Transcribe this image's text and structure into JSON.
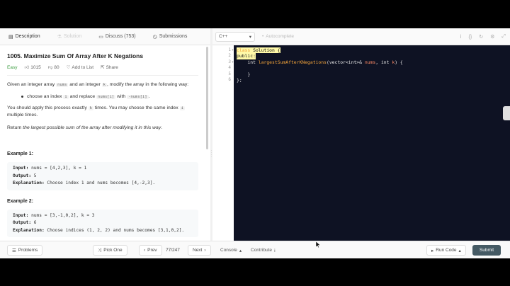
{
  "tabs": [
    {
      "label": "Description",
      "icon": "document-icon",
      "active": true
    },
    {
      "label": "Solution",
      "icon": "flask-icon",
      "disabled": true
    },
    {
      "label": "Discuss (753)",
      "icon": "chat-icon"
    },
    {
      "label": "Submissions",
      "icon": "history-icon"
    }
  ],
  "problem": {
    "title": "1005. Maximize Sum Of Array After K Negations",
    "difficulty": "Easy",
    "likes": "1015",
    "dislikes": "80",
    "add_to_list": "Add to List",
    "share": "Share",
    "intro_a": "Given an integer array ",
    "intro_code1": "nums",
    "intro_b": " and an integer ",
    "intro_code2": "k",
    "intro_c": ", modify the array in the following way:",
    "bullet_a": "choose an index ",
    "bullet_code1": "i",
    "bullet_b": " and replace ",
    "bullet_code2": "nums[i]",
    "bullet_c": " with ",
    "bullet_code3": "-nums[i]",
    "bullet_d": ".",
    "apply_a": "You should apply this process exactly ",
    "apply_code": "k",
    "apply_b": " times. You may choose the same index ",
    "apply_code2": "i",
    "apply_c": " multiple times.",
    "return_a": "Return ",
    "return_em": "the largest possible sum of the array after modifying it in this way",
    "return_b": ".",
    "examples": [
      {
        "heading": "Example 1:",
        "input_label": "Input:",
        "input": " nums = [4,2,3], k = 1",
        "output_label": "Output:",
        "output": " 5",
        "expl_label": "Explanation:",
        "expl": " Choose index 1 and nums becomes [4,-2,3]."
      },
      {
        "heading": "Example 2:",
        "input_label": "Input:",
        "input": " nums = [3,-1,0,2], k = 3",
        "output_label": "Output:",
        "output": " 6",
        "expl_label": "Explanation:",
        "expl": " Choose indices (1, 2, 2) and nums becomes [3,1,0,2]."
      }
    ]
  },
  "editor": {
    "language": "C++",
    "autocomplete": "Autocomplete",
    "line_numbers": [
      "1",
      "2",
      "3",
      "4",
      "5",
      "6"
    ],
    "code": {
      "l1_kw": "class",
      "l1_rest": " Solution {",
      "l2": "public:",
      "l3_indent": "    ",
      "l3_type": "int",
      "l3_fn": " largestSumAfterKNegations",
      "l3_args1": "(vector<int>& ",
      "l3_p1": "nums",
      "l3_args2": ", int ",
      "l3_p2": "k",
      "l3_end": ") {",
      "l4": "        ",
      "l5": "    }",
      "l6": "};"
    }
  },
  "bottom": {
    "problems": "Problems",
    "pick_one": "Pick One",
    "prev": "Prev",
    "page": "77/247",
    "next": "Next",
    "console": "Console",
    "contribute": "Contribute",
    "run_code": "Run Code",
    "submit": "Submit"
  }
}
